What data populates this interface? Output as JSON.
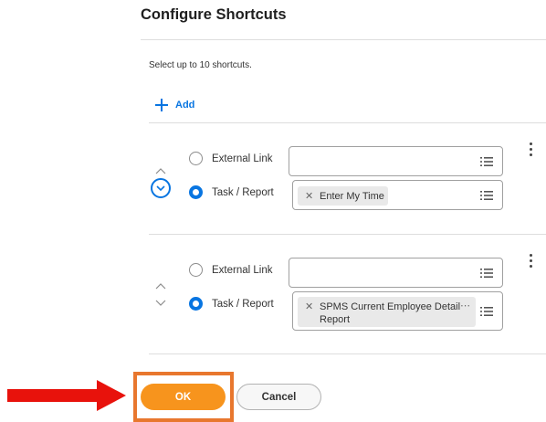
{
  "header": {
    "title": "Configure Shortcuts"
  },
  "instructions": "Select up to 10 shortcuts.",
  "add_button": {
    "label": "Add",
    "icon": "plus-icon"
  },
  "shortcuts": [
    {
      "options": [
        {
          "label": "External Link",
          "selected": false
        },
        {
          "label": "Task / Report",
          "selected": true
        }
      ],
      "external_link_value": "",
      "task_report_value": "Enter My Time"
    },
    {
      "options": [
        {
          "label": "External Link",
          "selected": false
        },
        {
          "label": "Task / Report",
          "selected": true
        }
      ],
      "external_link_value": "",
      "task_report_value_line1": "SPMS Current Employee Detail",
      "task_report_value_line2": "Report"
    }
  ],
  "footer": {
    "ok_label": "OK",
    "cancel_label": "Cancel"
  },
  "colors": {
    "accent": "#0875e1",
    "ok_button": "#f7941d",
    "highlight_box": "#e8772e",
    "pointer_arrow": "#e8120c"
  }
}
